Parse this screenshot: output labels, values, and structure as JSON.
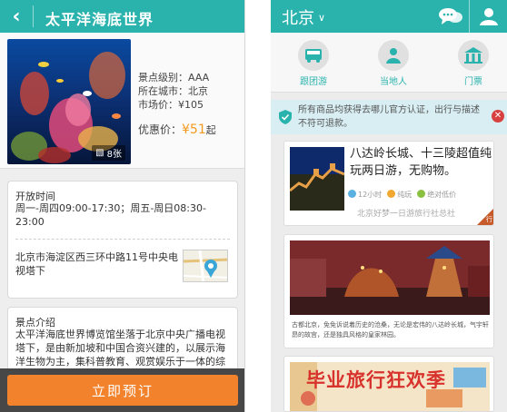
{
  "left": {
    "header": {
      "title": "太平洋海底世界"
    },
    "photo": {
      "count": "8张"
    },
    "meta": {
      "level": "景点级别：AAA",
      "city": "所在城市：北京",
      "market_price": "市场价：¥105"
    },
    "price": {
      "label": "优惠价：",
      "value": "¥51",
      "suffix": "起"
    },
    "hours": {
      "title": "开放时间",
      "text": "周一-周四09:00-17:30；周五-周日08:30-23:00"
    },
    "address": {
      "text": "北京市海淀区西三环中路11号中央电视塔下"
    },
    "intro": {
      "title": "景点介绍",
      "text": "太平洋海底世界博览馆坐落于北京中央广播电视塔下，是由新加坡和中国合资兴建的，以展示海洋生物为主，集科普教育、观赏娱乐于一体的综合现代化..."
    },
    "book_button": "立即预订",
    "colors": {
      "header": "#2ab3ad",
      "accent": "#f2832c",
      "price": "#f39a1f"
    }
  },
  "right": {
    "header": {
      "city": "北京"
    },
    "nav": [
      {
        "label": "跟团游",
        "icon": "bus-icon"
      },
      {
        "label": "当地人",
        "icon": "person-icon"
      },
      {
        "label": "门票",
        "icon": "ticket-building-icon"
      }
    ],
    "notice": {
      "text": "所有商品均获得去哪儿官方认证，出行与描述不符可退款。"
    },
    "card1": {
      "title": "八达岭长城、十三陵超值纯玩两日游，无购物。",
      "tags": [
        "12小时",
        "纯玩",
        "绝对低价"
      ],
      "subtitle": "北京好梦一日游旅行社总社",
      "corner": "行"
    },
    "card2": {
      "text": "古都北京，免免诉说着历史的沧桑，无论是宏伟的八达岭长城，气宇轩昂的故宫，还是独具风格的皇家林园。"
    },
    "card3": {
      "title": "毕业旅行狂欢季"
    }
  }
}
